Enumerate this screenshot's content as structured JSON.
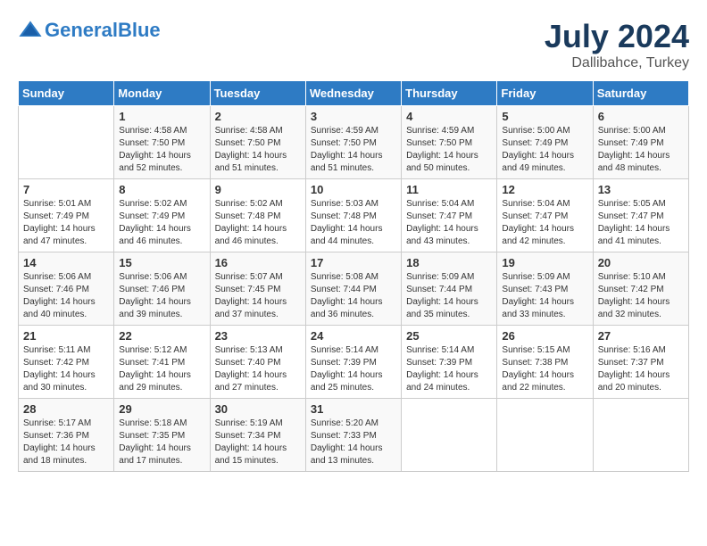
{
  "header": {
    "logo_line1": "General",
    "logo_line2": "Blue",
    "month_year": "July 2024",
    "location": "Dallibahce, Turkey"
  },
  "weekdays": [
    "Sunday",
    "Monday",
    "Tuesday",
    "Wednesday",
    "Thursday",
    "Friday",
    "Saturday"
  ],
  "weeks": [
    [
      {
        "date": "",
        "sunrise": "",
        "sunset": "",
        "daylight": ""
      },
      {
        "date": "1",
        "sunrise": "Sunrise: 4:58 AM",
        "sunset": "Sunset: 7:50 PM",
        "daylight": "Daylight: 14 hours and 52 minutes."
      },
      {
        "date": "2",
        "sunrise": "Sunrise: 4:58 AM",
        "sunset": "Sunset: 7:50 PM",
        "daylight": "Daylight: 14 hours and 51 minutes."
      },
      {
        "date": "3",
        "sunrise": "Sunrise: 4:59 AM",
        "sunset": "Sunset: 7:50 PM",
        "daylight": "Daylight: 14 hours and 51 minutes."
      },
      {
        "date": "4",
        "sunrise": "Sunrise: 4:59 AM",
        "sunset": "Sunset: 7:50 PM",
        "daylight": "Daylight: 14 hours and 50 minutes."
      },
      {
        "date": "5",
        "sunrise": "Sunrise: 5:00 AM",
        "sunset": "Sunset: 7:49 PM",
        "daylight": "Daylight: 14 hours and 49 minutes."
      },
      {
        "date": "6",
        "sunrise": "Sunrise: 5:00 AM",
        "sunset": "Sunset: 7:49 PM",
        "daylight": "Daylight: 14 hours and 48 minutes."
      }
    ],
    [
      {
        "date": "7",
        "sunrise": "Sunrise: 5:01 AM",
        "sunset": "Sunset: 7:49 PM",
        "daylight": "Daylight: 14 hours and 47 minutes."
      },
      {
        "date": "8",
        "sunrise": "Sunrise: 5:02 AM",
        "sunset": "Sunset: 7:49 PM",
        "daylight": "Daylight: 14 hours and 46 minutes."
      },
      {
        "date": "9",
        "sunrise": "Sunrise: 5:02 AM",
        "sunset": "Sunset: 7:48 PM",
        "daylight": "Daylight: 14 hours and 46 minutes."
      },
      {
        "date": "10",
        "sunrise": "Sunrise: 5:03 AM",
        "sunset": "Sunset: 7:48 PM",
        "daylight": "Daylight: 14 hours and 44 minutes."
      },
      {
        "date": "11",
        "sunrise": "Sunrise: 5:04 AM",
        "sunset": "Sunset: 7:47 PM",
        "daylight": "Daylight: 14 hours and 43 minutes."
      },
      {
        "date": "12",
        "sunrise": "Sunrise: 5:04 AM",
        "sunset": "Sunset: 7:47 PM",
        "daylight": "Daylight: 14 hours and 42 minutes."
      },
      {
        "date": "13",
        "sunrise": "Sunrise: 5:05 AM",
        "sunset": "Sunset: 7:47 PM",
        "daylight": "Daylight: 14 hours and 41 minutes."
      }
    ],
    [
      {
        "date": "14",
        "sunrise": "Sunrise: 5:06 AM",
        "sunset": "Sunset: 7:46 PM",
        "daylight": "Daylight: 14 hours and 40 minutes."
      },
      {
        "date": "15",
        "sunrise": "Sunrise: 5:06 AM",
        "sunset": "Sunset: 7:46 PM",
        "daylight": "Daylight: 14 hours and 39 minutes."
      },
      {
        "date": "16",
        "sunrise": "Sunrise: 5:07 AM",
        "sunset": "Sunset: 7:45 PM",
        "daylight": "Daylight: 14 hours and 37 minutes."
      },
      {
        "date": "17",
        "sunrise": "Sunrise: 5:08 AM",
        "sunset": "Sunset: 7:44 PM",
        "daylight": "Daylight: 14 hours and 36 minutes."
      },
      {
        "date": "18",
        "sunrise": "Sunrise: 5:09 AM",
        "sunset": "Sunset: 7:44 PM",
        "daylight": "Daylight: 14 hours and 35 minutes."
      },
      {
        "date": "19",
        "sunrise": "Sunrise: 5:09 AM",
        "sunset": "Sunset: 7:43 PM",
        "daylight": "Daylight: 14 hours and 33 minutes."
      },
      {
        "date": "20",
        "sunrise": "Sunrise: 5:10 AM",
        "sunset": "Sunset: 7:42 PM",
        "daylight": "Daylight: 14 hours and 32 minutes."
      }
    ],
    [
      {
        "date": "21",
        "sunrise": "Sunrise: 5:11 AM",
        "sunset": "Sunset: 7:42 PM",
        "daylight": "Daylight: 14 hours and 30 minutes."
      },
      {
        "date": "22",
        "sunrise": "Sunrise: 5:12 AM",
        "sunset": "Sunset: 7:41 PM",
        "daylight": "Daylight: 14 hours and 29 minutes."
      },
      {
        "date": "23",
        "sunrise": "Sunrise: 5:13 AM",
        "sunset": "Sunset: 7:40 PM",
        "daylight": "Daylight: 14 hours and 27 minutes."
      },
      {
        "date": "24",
        "sunrise": "Sunrise: 5:14 AM",
        "sunset": "Sunset: 7:39 PM",
        "daylight": "Daylight: 14 hours and 25 minutes."
      },
      {
        "date": "25",
        "sunrise": "Sunrise: 5:14 AM",
        "sunset": "Sunset: 7:39 PM",
        "daylight": "Daylight: 14 hours and 24 minutes."
      },
      {
        "date": "26",
        "sunrise": "Sunrise: 5:15 AM",
        "sunset": "Sunset: 7:38 PM",
        "daylight": "Daylight: 14 hours and 22 minutes."
      },
      {
        "date": "27",
        "sunrise": "Sunrise: 5:16 AM",
        "sunset": "Sunset: 7:37 PM",
        "daylight": "Daylight: 14 hours and 20 minutes."
      }
    ],
    [
      {
        "date": "28",
        "sunrise": "Sunrise: 5:17 AM",
        "sunset": "Sunset: 7:36 PM",
        "daylight": "Daylight: 14 hours and 18 minutes."
      },
      {
        "date": "29",
        "sunrise": "Sunrise: 5:18 AM",
        "sunset": "Sunset: 7:35 PM",
        "daylight": "Daylight: 14 hours and 17 minutes."
      },
      {
        "date": "30",
        "sunrise": "Sunrise: 5:19 AM",
        "sunset": "Sunset: 7:34 PM",
        "daylight": "Daylight: 14 hours and 15 minutes."
      },
      {
        "date": "31",
        "sunrise": "Sunrise: 5:20 AM",
        "sunset": "Sunset: 7:33 PM",
        "daylight": "Daylight: 14 hours and 13 minutes."
      },
      {
        "date": "",
        "sunrise": "",
        "sunset": "",
        "daylight": ""
      },
      {
        "date": "",
        "sunrise": "",
        "sunset": "",
        "daylight": ""
      },
      {
        "date": "",
        "sunrise": "",
        "sunset": "",
        "daylight": ""
      }
    ]
  ]
}
